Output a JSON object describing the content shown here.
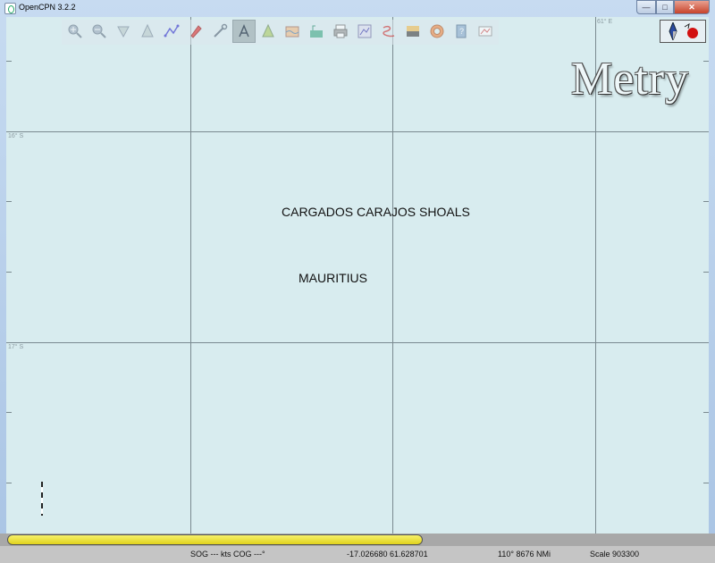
{
  "window": {
    "title": "OpenCPN 3.2.2",
    "minimize": "—",
    "maximize": "□",
    "close": "✕"
  },
  "toolbar": {
    "buttons": [
      {
        "name": "zoom-in-icon",
        "glyph": "zoom-in"
      },
      {
        "name": "zoom-out-icon",
        "glyph": "zoom-out"
      },
      {
        "name": "scale-in-icon",
        "glyph": "scale-in"
      },
      {
        "name": "scale-out-icon",
        "glyph": "scale-out"
      },
      {
        "name": "route-icon",
        "glyph": "route"
      },
      {
        "name": "follow-ship-icon",
        "glyph": "ship"
      },
      {
        "name": "settings-icon",
        "glyph": "wrench"
      },
      {
        "name": "text-icon",
        "glyph": "text"
      },
      {
        "name": "current-icon",
        "glyph": "current"
      },
      {
        "name": "tide-icon",
        "glyph": "tide"
      },
      {
        "name": "chart-icon",
        "glyph": "chart"
      },
      {
        "name": "print-icon",
        "glyph": "print"
      },
      {
        "name": "route-manager-icon",
        "glyph": "route-mgr"
      },
      {
        "name": "track-icon",
        "glyph": "track"
      },
      {
        "name": "color-scheme-icon",
        "glyph": "color"
      },
      {
        "name": "mob-icon",
        "glyph": "mob"
      },
      {
        "name": "help-icon",
        "glyph": "help"
      },
      {
        "name": "about-icon",
        "glyph": "about"
      }
    ],
    "active_index": 7
  },
  "compass": {
    "icons": [
      "compass-icon",
      "record-icon"
    ],
    "record_color": "#d21010"
  },
  "chart": {
    "lat_labels": [
      "16° S",
      "17° S"
    ],
    "lon_labels": [
      "",
      "61° E"
    ],
    "overlay_title": "Metry",
    "places": [
      "CARGADOS CARAJOS SHOALS",
      "MAURITIUS"
    ],
    "water_color": "#d8ecef"
  },
  "progress": {
    "value": 0.59,
    "color": "#ece040"
  },
  "status": {
    "sog_cog": "SOG --- kts  COG ---°",
    "position": "-17.026680   61.628701",
    "bearing_dist": "110°  8676 NMi",
    "scale": "Scale 903300"
  }
}
